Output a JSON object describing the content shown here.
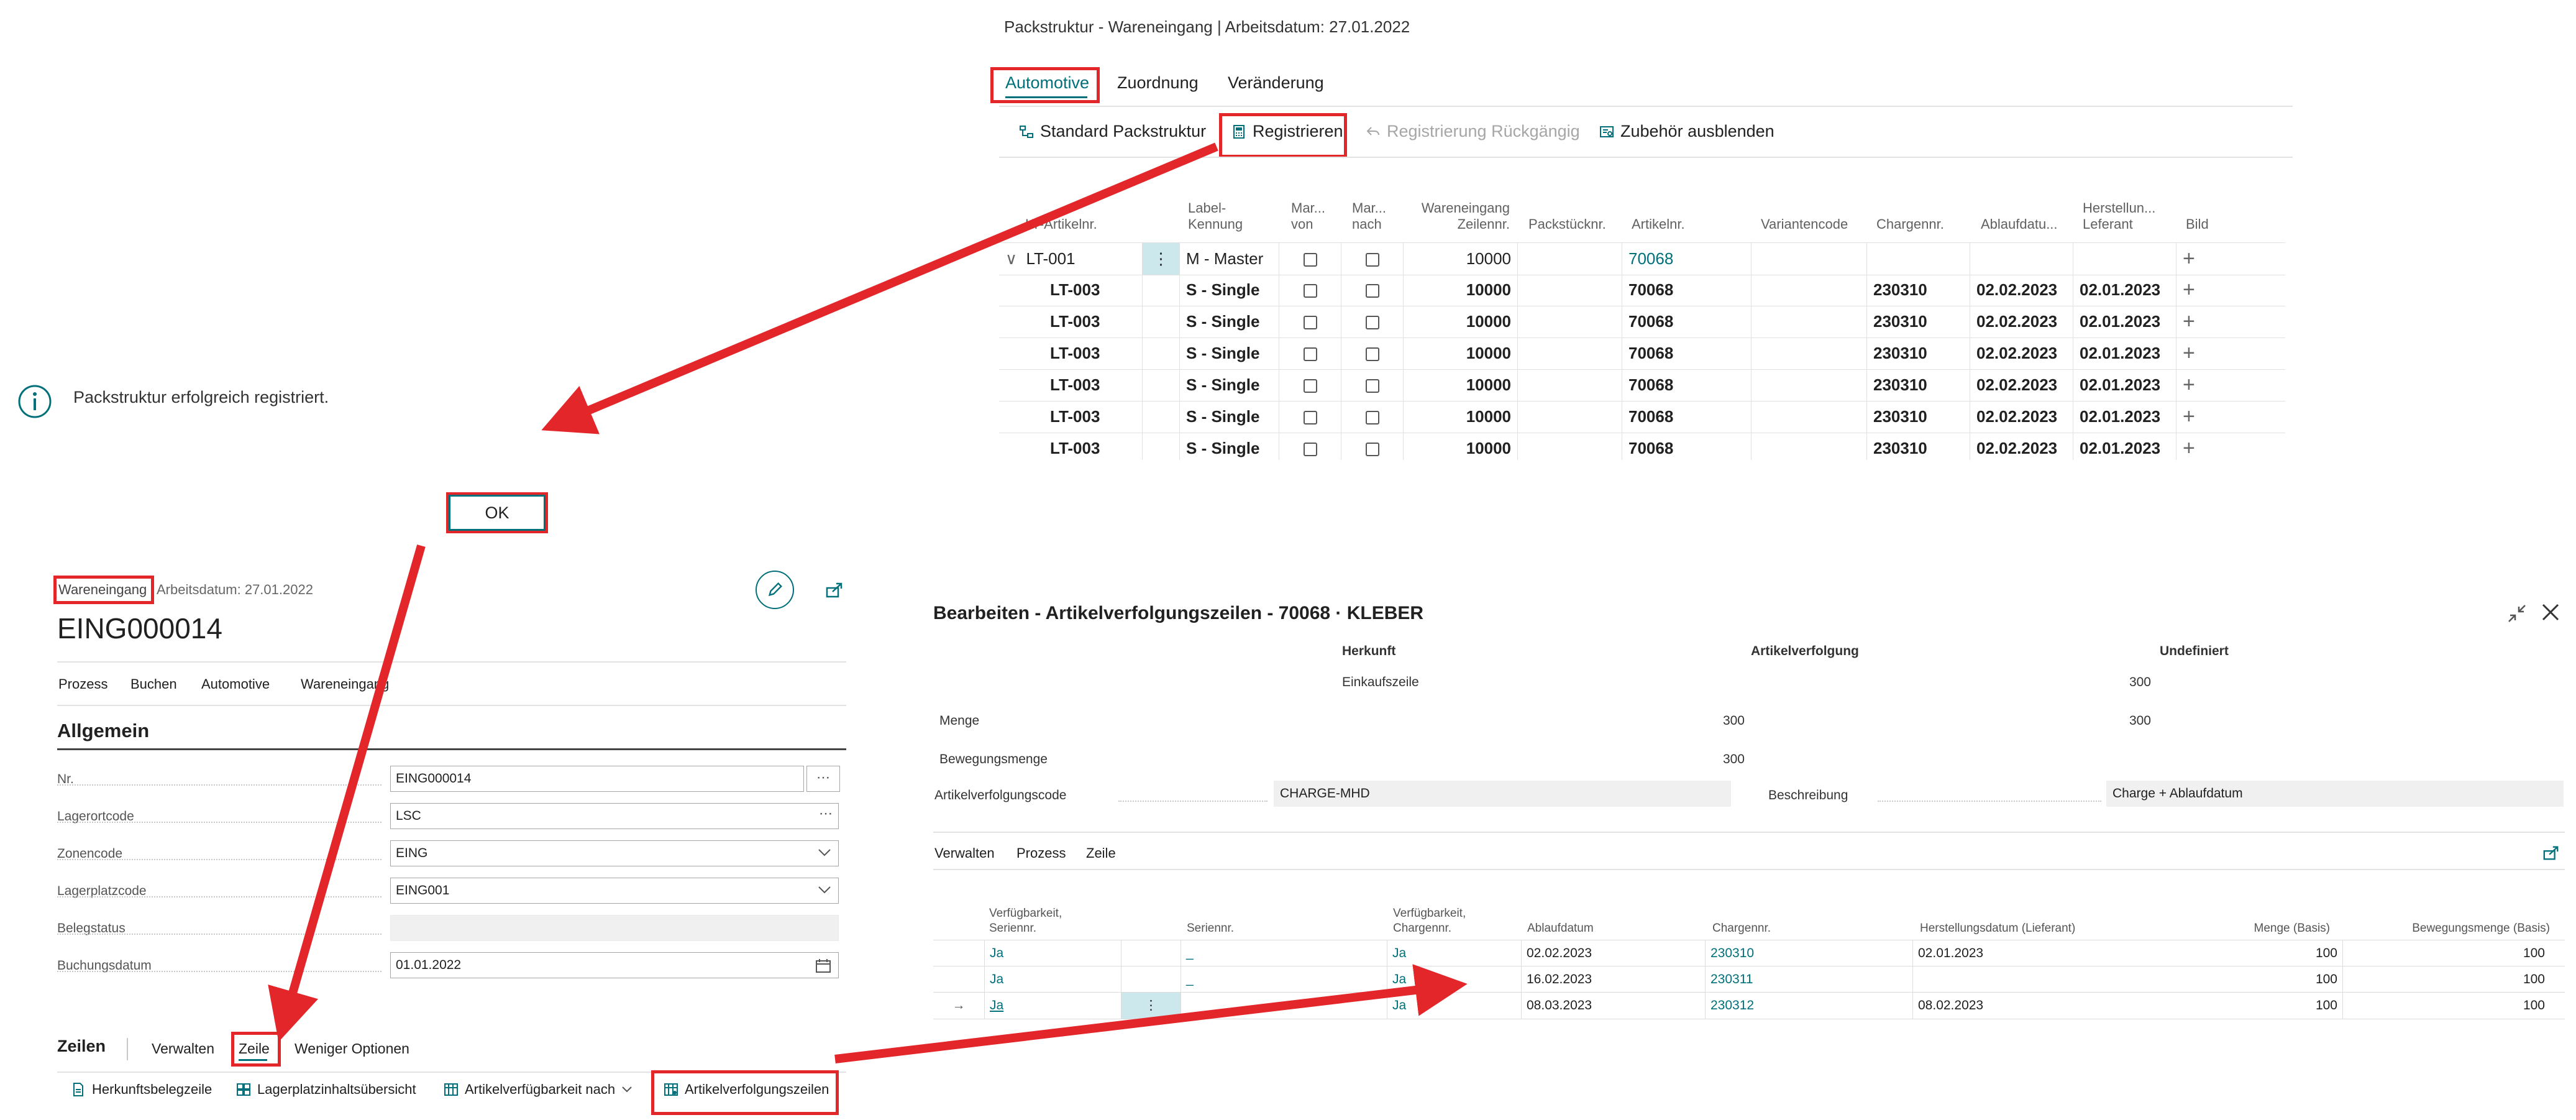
{
  "packstruktur": {
    "title": "Packstruktur - Wareneingang | Arbeitsdatum: 27.01.2022",
    "tabs": [
      "Automotive",
      "Zuordnung",
      "Veränderung"
    ],
    "actions": {
      "standard": "Standard Packstruktur",
      "register": "Registrieren",
      "undo": "Registrierung Rückgängig",
      "hide": "Zubehör ausblenden"
    },
    "columns": {
      "lt": "LT-Artikelnr.",
      "label1": "Label-",
      "label2": "Kennung",
      "marvon1": "Mar...",
      "marvon2": "von",
      "marnach1": "Mar...",
      "marnach2": "nach",
      "we1": "Wareneingang",
      "we2": "Zeilennr.",
      "packst": "Packstücknr.",
      "artikel": "Artikelnr.",
      "variante": "Variantencode",
      "charge": "Chargennr.",
      "ablauf": "Ablaufdatu...",
      "herst1": "Herstellun...",
      "herst2": "Leferant",
      "bild": "Bild"
    },
    "rows": [
      {
        "lt": "LT-001",
        "label": "M - Master",
        "line": "10000",
        "item": "70068",
        "lot": "",
        "exp": "",
        "mfg": ""
      },
      {
        "lt": "LT-003",
        "label": "S - Single",
        "line": "10000",
        "item": "70068",
        "lot": "230310",
        "exp": "02.02.2023",
        "mfg": "02.01.2023"
      },
      {
        "lt": "LT-003",
        "label": "S - Single",
        "line": "10000",
        "item": "70068",
        "lot": "230310",
        "exp": "02.02.2023",
        "mfg": "02.01.2023"
      },
      {
        "lt": "LT-003",
        "label": "S - Single",
        "line": "10000",
        "item": "70068",
        "lot": "230310",
        "exp": "02.02.2023",
        "mfg": "02.01.2023"
      },
      {
        "lt": "LT-003",
        "label": "S - Single",
        "line": "10000",
        "item": "70068",
        "lot": "230310",
        "exp": "02.02.2023",
        "mfg": "02.01.2023"
      },
      {
        "lt": "LT-003",
        "label": "S - Single",
        "line": "10000",
        "item": "70068",
        "lot": "230310",
        "exp": "02.02.2023",
        "mfg": "02.01.2023"
      },
      {
        "lt": "LT-003",
        "label": "S - Single",
        "line": "10000",
        "item": "70068",
        "lot": "230310",
        "exp": "02.02.2023",
        "mfg": "02.01.2023"
      }
    ]
  },
  "info": {
    "message": "Packstruktur erfolgreich registriert.",
    "ok": "OK"
  },
  "wareneingang": {
    "breadcrumb": "Wareneingang",
    "workdate": "Arbeitsdatum: 27.01.2022",
    "number": "EING000014",
    "menu": [
      "Prozess",
      "Buchen",
      "Automotive",
      "Wareneingang"
    ],
    "section": "Allgemein",
    "fields": {
      "nr": {
        "label": "Nr.",
        "value": "EING000014"
      },
      "lagerort": {
        "label": "Lagerortcode",
        "value": "LSC"
      },
      "zone": {
        "label": "Zonencode",
        "value": "EING"
      },
      "lagerplatz": {
        "label": "Lagerplatzcode",
        "value": "EING001"
      },
      "belegstatus": {
        "label": "Belegstatus",
        "value": ""
      },
      "buchungsdatum": {
        "label": "Buchungsdatum",
        "value": "01.01.2022"
      }
    },
    "lines": {
      "title": "Zeilen",
      "tabs": [
        "Verwalten",
        "Zeile",
        "Weniger Optionen"
      ],
      "actions": [
        "Herkunftsbelegzeile",
        "Lagerplatzinhaltsübersicht",
        "Artikelverfügbarkeit nach",
        "Artikelverfolgungszeilen"
      ]
    }
  },
  "tracking": {
    "title": "Bearbeiten - Artikelverfolgungszeilen - 70068 · KLEBER",
    "headers": {
      "herkunft": "Herkunft",
      "artikelverfolgung": "Artikelverfolgung",
      "undefiniert": "Undefiniert"
    },
    "einkaufszeile": "Einkaufszeile",
    "einkauf_undef": "300",
    "menge": {
      "label": "Menge",
      "av": "300",
      "undef": "300"
    },
    "bewegungsmenge": {
      "label": "Bewegungsmenge",
      "av": "300"
    },
    "code": {
      "label": "Artikelverfolgungscode",
      "value": "CHARGE-MHD"
    },
    "beschreibung": {
      "label": "Beschreibung",
      "value": "Charge + Ablaufdatum"
    },
    "menu": [
      "Verwalten",
      "Prozess",
      "Zeile"
    ],
    "columns": {
      "vs1": "Verfügbarkeit,",
      "vs2": "Seriennr.",
      "serial": "Seriennr.",
      "vc1": "Verfügbarkeit,",
      "vc2": "Chargennr.",
      "ablauf": "Ablaufdatum",
      "charge": "Chargennr.",
      "herst": "Herstellungsdatum (Lieferant)",
      "menge": "Menge (Basis)",
      "bewegung": "Bewegungsmenge (Basis)"
    },
    "rows": [
      {
        "avs": "Ja",
        "serial": "_",
        "avc": "Ja",
        "exp": "02.02.2023",
        "lot": "230310",
        "mfg": "02.01.2023",
        "qty": "100",
        "move": "100"
      },
      {
        "avs": "Ja",
        "serial": "_",
        "avc": "Ja",
        "exp": "16.02.2023",
        "lot": "230311",
        "mfg": "",
        "qty": "100",
        "move": "100"
      },
      {
        "avs": "Ja",
        "serial": "",
        "avc": "Ja",
        "exp": "08.03.2023",
        "lot": "230312",
        "mfg": "08.02.2023",
        "qty": "100",
        "move": "100"
      }
    ]
  },
  "colors": {
    "accent": "#00707a",
    "highlight": "#e3262a",
    "selected_cell": "#cde8ec"
  }
}
